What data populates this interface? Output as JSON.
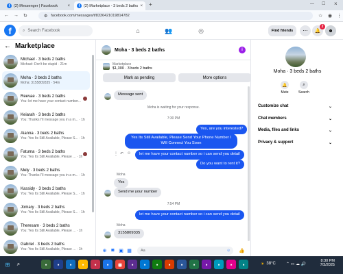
{
  "browser": {
    "tabs": [
      {
        "title": "(2) Messenger | Facebook"
      },
      {
        "title": "(2) Marketplace - 3 beds 2 baths"
      }
    ],
    "new_tab": "+",
    "url": "facebook.com/messages/t/8336421019814782"
  },
  "header": {
    "search_placeholder": "Search Facebook",
    "find_friends": "Find friends",
    "notification_count": "2"
  },
  "marketplace": {
    "title": "Marketplace",
    "conversations": [
      {
        "name": "Michael · 3 beds 2 baths",
        "preview": "Michael: Don't be stupid · 21m"
      },
      {
        "name": "Moha · 3 beds 2 baths",
        "preview": "Moha: 3155809335 · 54m"
      },
      {
        "name": "Reevae · 3 beds 2 baths",
        "preview": "You: let me have your contact number..."
      },
      {
        "name": "Keiarah · 3 beds 2 baths",
        "preview": "You: Thanks I'll message you in a m... · 1h"
      },
      {
        "name": "Aianna · 3 beds 2 baths",
        "preview": "You: Yes Its Still Available, Please S... · 1h"
      },
      {
        "name": "Fatuma · 3 beds 2 baths",
        "preview": "You: Yes Its Still Available, Please ... · 1h"
      },
      {
        "name": "Mely · 3 beds 2 baths",
        "preview": "You: Thanks I'll message you in a m... · 1h"
      },
      {
        "name": "Kassidy · 3 beds 2 baths",
        "preview": "You: Yes Its Still Available, Please S... · 1h"
      },
      {
        "name": "Jomary · 3 beds 2 baths",
        "preview": "You: Yes Its Still Available, Please S... · 1h"
      },
      {
        "name": "Theresam · 3 beds 2 baths",
        "preview": "You: Yes Its Still Available, Please ... · 1h"
      },
      {
        "name": "Gabriel · 3 beds 2 baths",
        "preview": "You: Yes Its Still Available, Please ... · 1h"
      }
    ]
  },
  "chat": {
    "title": "Moha · 3 beds 2 baths",
    "listing_label": "Marketplace",
    "listing_price": "$1,300 · 3 beds 2 baths",
    "mark_pending": "Mark as pending",
    "more_options": "More options",
    "message_sent": "Message sent",
    "waiting": "Moha is waiting for your response.",
    "time1": "7:30 PM",
    "out1": "Yes, are you interested?",
    "out2": "Yes Its Still Available, Please Send Your Phone Number I Will Connect You Soon",
    "out3": "let me have your contact number so i can send you detail",
    "out4": "Do you want to rent it?",
    "sender": "Moha",
    "in1": "Yes",
    "in2": "Send me your number",
    "time2": "7:54 PM",
    "out5": "let me have your contact number so i can send you detail",
    "sender2": "Moha",
    "in3": "3155809335",
    "composer_placeholder": "Aa"
  },
  "details": {
    "title": "Moha · 3 beds 2 baths",
    "mute": "Mute",
    "search": "Search",
    "sections": [
      "Customize chat",
      "Chat members",
      "Media, files and links",
      "Privacy & support"
    ]
  },
  "taskbar": {
    "weather": "38°C",
    "time": "8:30 PM",
    "date": "7/3/2025"
  },
  "colors": {
    "brand": "#1877f2",
    "outgoing_bubble": "#1a56f0",
    "incoming_bubble": "#e4e6eb",
    "active_conversation": "#ebf5ff"
  }
}
